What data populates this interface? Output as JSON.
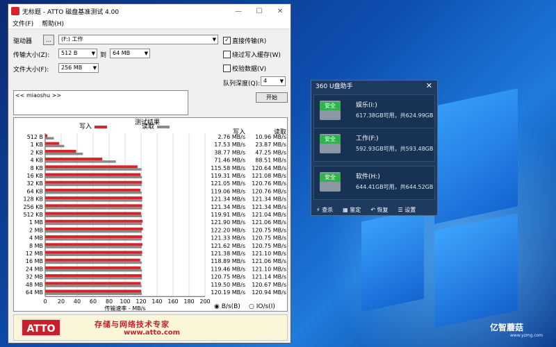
{
  "window": {
    "title": "无标题 - ATTO 磁盘基准测试 4.00",
    "minimize": "—",
    "maximize": "☐",
    "close": "✕"
  },
  "menu": [
    {
      "label": "文件(F)"
    },
    {
      "label": "帮助(H)"
    }
  ],
  "controls": {
    "drive_label": "驱动器",
    "browse_label": "...",
    "drive_value": "(F:) 工作",
    "transfer_label": "传输大小(Z):",
    "transfer_from": "512 B",
    "to_label": "到",
    "transfer_to": "64 MB",
    "file_size_label": "文件大小(F):",
    "file_size": "256 MB",
    "direct_io": {
      "label": "直接传输(R)",
      "checked": "✓"
    },
    "bypass_cache": {
      "label": "绕过写入缓存(W)",
      "checked": ""
    },
    "verify": {
      "label": "校验数据(V)",
      "checked": ""
    },
    "queue_label": "队列深度(Q):",
    "queue_value": "4",
    "start_button": "开始",
    "notes": "<< miaoshu >>"
  },
  "results": {
    "title": "测试结果",
    "write_label": "写入",
    "read_label": "读取",
    "col_write": "写入",
    "col_read": "读取",
    "xlabel": "传输速率 - MB/s",
    "unit_bs": "B/s(B)",
    "unit_ios": "IO/s(I)"
  },
  "banner": {
    "logo": "ATTO",
    "text": "存储与网络技术专家",
    "url": "www.atto.com"
  },
  "helper": {
    "title": "360 U盘助手",
    "close": "✕",
    "badge": "安全",
    "drives": [
      {
        "name": "娱乐(I:)",
        "info": "617.38GB可用，共624.99GB"
      },
      {
        "name": "工作(F:)",
        "info": "592.93GB可用，共593.48GB"
      },
      {
        "name": "软件(H:)",
        "info": "644.41GB可用，共644.52GB"
      }
    ],
    "actions": [
      "⚡ 查杀",
      "▦ 鉴定",
      "↶ 恢复",
      "☰ 设置"
    ]
  },
  "watermark": {
    "name": "亿智蘑菇",
    "url": "www.yzmg.com"
  },
  "chart_data": {
    "type": "bar",
    "orientation": "horizontal",
    "title": "测试结果",
    "xlabel": "传输速率 - MB/s",
    "xlim": [
      0,
      200
    ],
    "xticks": [
      0,
      20,
      40,
      60,
      80,
      100,
      120,
      140,
      160,
      180,
      200
    ],
    "categories": [
      "512 B",
      "1 KB",
      "2 KB",
      "4 KB",
      "8 KB",
      "16 KB",
      "32 KB",
      "64 KB",
      "128 KB",
      "256 KB",
      "512 KB",
      "1 MB",
      "2 MB",
      "4 MB",
      "8 MB",
      "12 MB",
      "16 MB",
      "24 MB",
      "32 MB",
      "48 MB",
      "64 MB"
    ],
    "series": [
      {
        "name": "写入",
        "color": "#d8232a",
        "values": [
          2.76,
          17.53,
          38.77,
          71.46,
          115.58,
          119.31,
          121.05,
          119.06,
          121.34,
          121.34,
          119.91,
          121.9,
          122.2,
          121.33,
          121.62,
          121.38,
          118.89,
          119.46,
          120.75,
          119.5,
          120.19
        ],
        "labels": [
          "2.76 MB/s",
          "17.53 MB/s",
          "38.77 MB/s",
          "71.46 MB/s",
          "115.58 MB/s",
          "119.31 MB/s",
          "121.05 MB/s",
          "119.06 MB/s",
          "121.34 MB/s",
          "121.34 MB/s",
          "119.91 MB/s",
          "121.90 MB/s",
          "122.20 MB/s",
          "121.33 MB/s",
          "121.62 MB/s",
          "121.38 MB/s",
          "118.89 MB/s",
          "119.46 MB/s",
          "120.75 MB/s",
          "119.50 MB/s",
          "120.19 MB/s"
        ]
      },
      {
        "name": "读取",
        "color": "#8a8a8a",
        "values": [
          10.96,
          23.87,
          47.25,
          88.51,
          120.64,
          121.08,
          120.76,
          120.76,
          121.34,
          121.34,
          121.04,
          121.06,
          120.75,
          120.75,
          120.75,
          121.1,
          121.06,
          121.1,
          121.14,
          120.67,
          120.94
        ],
        "labels": [
          "10.96 MB/s",
          "23.87 MB/s",
          "47.25 MB/s",
          "88.51 MB/s",
          "120.64 MB/s",
          "121.08 MB/s",
          "120.76 MB/s",
          "120.76 MB/s",
          "121.34 MB/s",
          "121.34 MB/s",
          "121.04 MB/s",
          "121.06 MB/s",
          "120.75 MB/s",
          "120.75 MB/s",
          "120.75 MB/s",
          "121.10 MB/s",
          "121.06 MB/s",
          "121.10 MB/s",
          "121.14 MB/s",
          "120.67 MB/s",
          "120.94 MB/s"
        ]
      }
    ]
  }
}
